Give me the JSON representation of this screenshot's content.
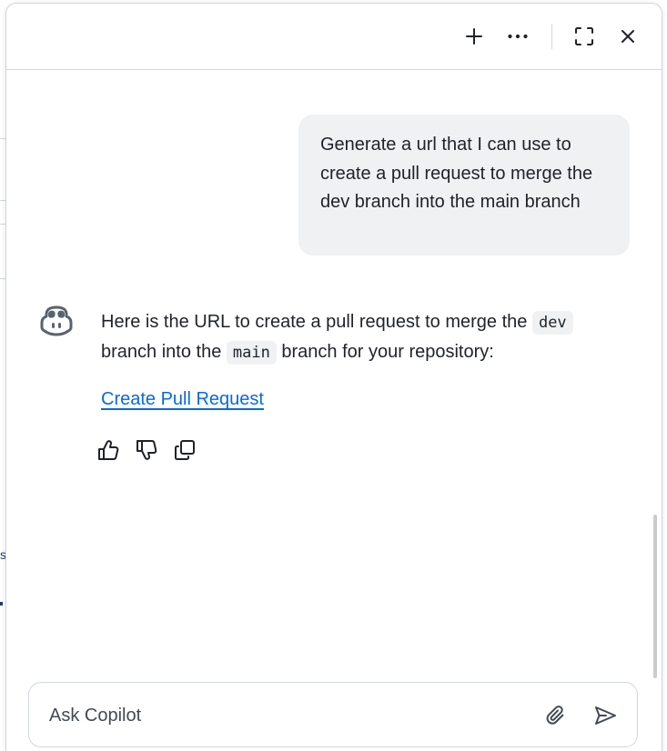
{
  "header": {
    "buttons": [
      {
        "name": "new-chat",
        "icon": "plus-icon"
      },
      {
        "name": "more-options",
        "icon": "kebab-horizontal-icon"
      },
      {
        "name": "fullscreen",
        "icon": "screen-full-icon"
      },
      {
        "name": "close",
        "icon": "x-icon"
      }
    ]
  },
  "conversation": {
    "user_message": "Generate a url that I can use to create a pull request to merge the dev branch into the main branch",
    "assistant": {
      "avatar_icon": "copilot-icon",
      "text_part1": "Here is the URL to create a pull request to merge the ",
      "code1": "dev",
      "text_part2": " branch into the ",
      "code2": "main",
      "text_part3": " branch for your repository:",
      "link_label": "Create Pull Request",
      "feedback": [
        {
          "name": "thumbs-up",
          "icon": "thumbsup-icon"
        },
        {
          "name": "thumbs-down",
          "icon": "thumbsdown-icon"
        },
        {
          "name": "copy",
          "icon": "copy-icon"
        }
      ]
    }
  },
  "composer": {
    "placeholder": "Ask Copilot",
    "value": "",
    "attach_icon": "paperclip-icon",
    "send_icon": "paper-airplane-icon"
  },
  "background": {
    "edge_glyph": "s"
  },
  "colors": {
    "link": "#0969da",
    "bubble": "#eff1f3",
    "border": "#d0d7de",
    "text": "#1f2328",
    "icon": "#59636e"
  }
}
